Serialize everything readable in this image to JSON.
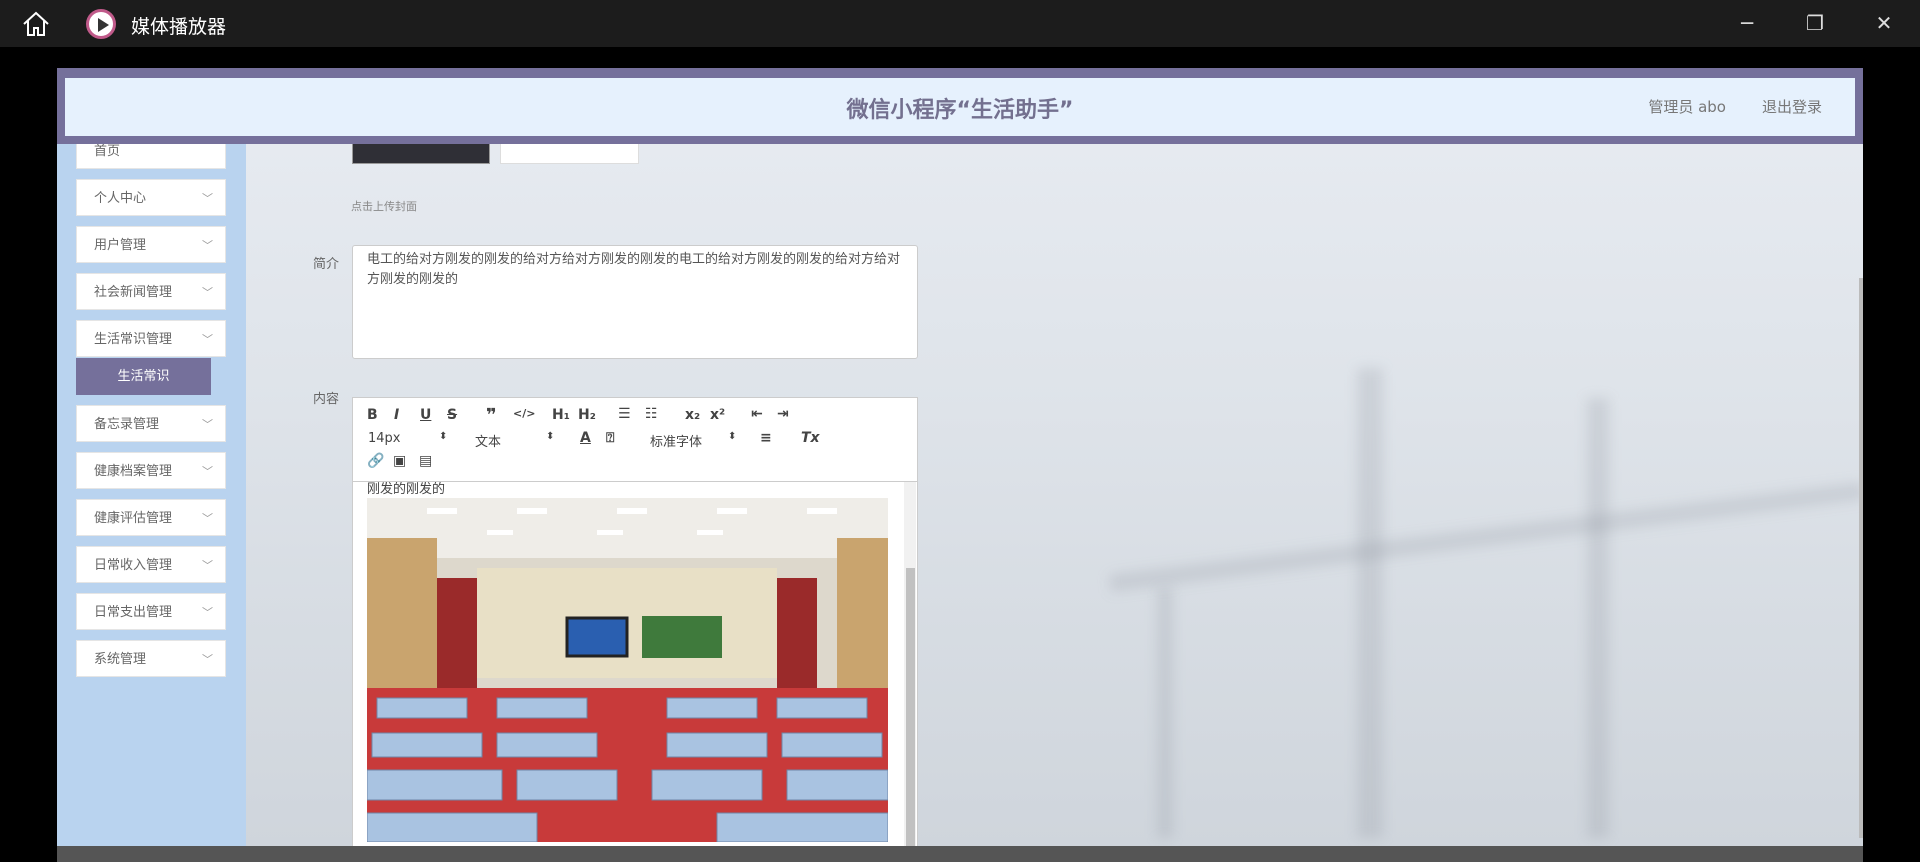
{
  "window": {
    "app_title": "媒体播放器",
    "icons": [
      "home-icon",
      "minimize-icon",
      "restore-icon",
      "close-icon"
    ]
  },
  "header": {
    "title": "微信小程序“生活助手”",
    "admin": "管理员 abo",
    "logout": "退出登录"
  },
  "sidebar": {
    "items": [
      {
        "label": "首页"
      },
      {
        "label": "个人中心"
      },
      {
        "label": "用户管理"
      },
      {
        "label": "社会新闻管理"
      },
      {
        "label": "生活常识管理"
      },
      {
        "label": "备忘录管理"
      },
      {
        "label": "健康档案管理"
      },
      {
        "label": "健康评估管理"
      },
      {
        "label": "日常收入管理"
      },
      {
        "label": "日常支出管理"
      },
      {
        "label": "系统管理"
      }
    ],
    "active_sub": "生活常识"
  },
  "form": {
    "upload_hint": "点击上传封面",
    "intro_label": "简介",
    "intro_value": "电工的给对方刚发的刚发的给对方给对方刚发的刚发的电工的给对方刚发的刚发的给对方给对方刚发的刚发的",
    "content_label": "内容",
    "editor": {
      "font_size": "14px",
      "paragraph": "文本",
      "font_family": "标准字体",
      "content_text": "刚发的刚发的"
    }
  },
  "colors": {
    "accent": "#75709b",
    "sidebar_bg": "#b9d3ef",
    "header_bg": "#e6f1fd"
  }
}
